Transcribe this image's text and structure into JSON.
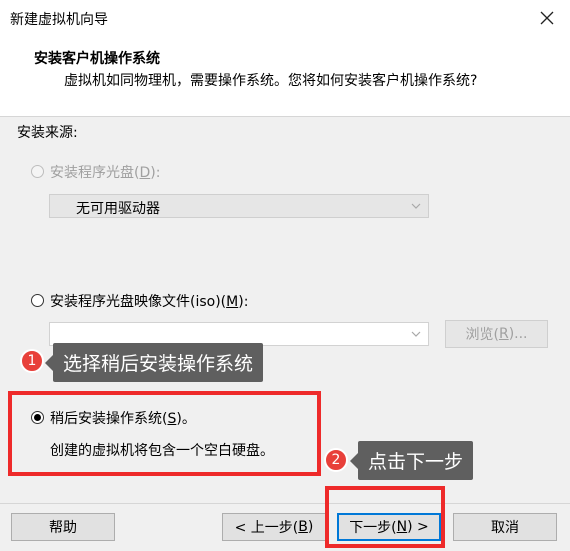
{
  "window": {
    "title": "新建虚拟机向导",
    "close_icon": "close-icon"
  },
  "header": {
    "title": "安装客户机操作系统",
    "subtitle": "虚拟机如同物理机，需要操作系统。您将如何安装客户机操作系统?"
  },
  "source": {
    "label": "安装来源:",
    "disc": {
      "label_before": "安装程序光盘(",
      "accel": "D",
      "label_after": "):",
      "drive_value": "无可用驱动器",
      "enabled": false,
      "selected": false
    },
    "iso": {
      "label_before": "安装程序光盘映像文件(iso)(",
      "accel": "M",
      "label_after": "):",
      "path_value": "",
      "browse_before": "浏览(",
      "browse_accel": "R",
      "browse_after": ")...",
      "selected": false
    },
    "later": {
      "label_before": "稍后安装操作系统(",
      "accel": "S",
      "label_after": ")。",
      "description": "创建的虚拟机将包含一个空白硬盘。",
      "selected": true
    }
  },
  "footer": {
    "help": "帮助",
    "back_before": "< 上一步(",
    "back_accel": "B",
    "back_after": ")",
    "next_before": "下一步(",
    "next_accel": "N",
    "next_after": ") >",
    "cancel": "取消"
  },
  "annotations": {
    "step1_number": "1",
    "step1_text": "选择稍后安装操作系统",
    "step2_number": "2",
    "step2_text": "点击下一步",
    "highlight_color": "#ee2a2a",
    "badge_color": "#e8403a",
    "tip_color": "#5f5f5f"
  }
}
